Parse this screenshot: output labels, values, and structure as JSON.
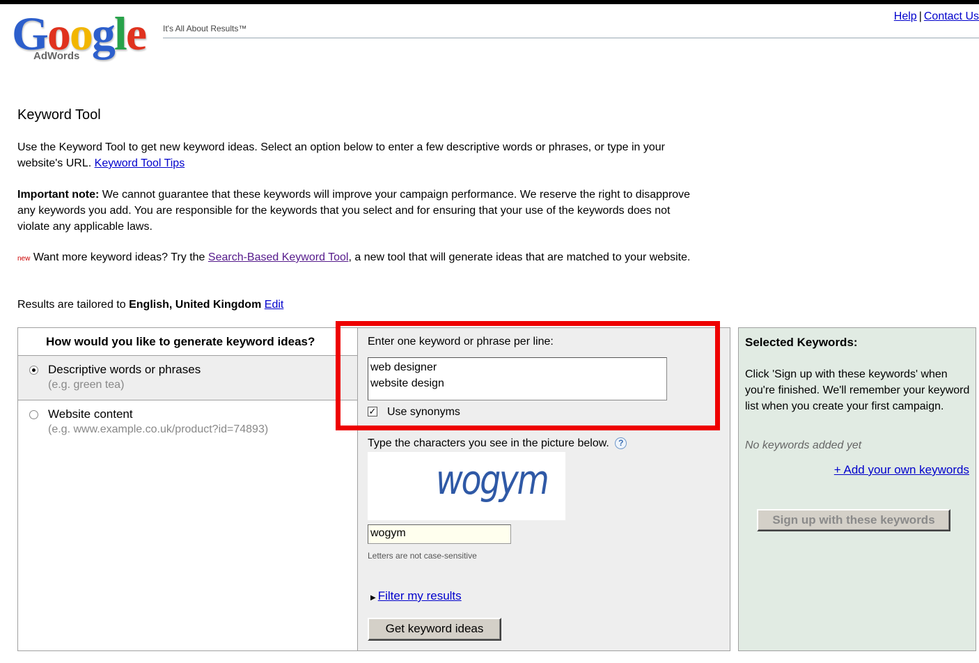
{
  "header": {
    "logo_text": "Google",
    "logo_sub": "AdWords",
    "tagline": "It's All About Results™",
    "help_link": "Help",
    "separator": "|",
    "contact_link": "Contact Us"
  },
  "intro": {
    "title": "Keyword Tool",
    "p1_text": "Use the Keyword Tool to get new keyword ideas. Select an option below to enter a few descriptive words or phrases, or type in your website's URL.",
    "p1_link": "Keyword Tool Tips",
    "p2_bold": "Important note:",
    "p2_text": "We cannot guarantee that these keywords will improve your campaign performance. We reserve the right to disapprove any keywords you add. You are responsible for the keywords that you select and for ensuring that your use of the keywords does not violate any applicable laws.",
    "p3_new": "new",
    "p3_before": "Want more keyword ideas? Try the",
    "p3_link": "Search-Based Keyword Tool",
    "p3_after": ", a new tool that will generate ideas that are matched to your website.",
    "p4_text": "Results are tailored to",
    "p4_bold": "English, United Kingdom",
    "p4_link": "Edit"
  },
  "left_panel": {
    "heading": "How would you like to generate keyword ideas?",
    "options": [
      {
        "label": "Descriptive words or phrases",
        "example": "(e.g. green tea)",
        "selected": true
      },
      {
        "label": "Website content",
        "example": "(e.g. www.example.co.uk/product?id=74893)",
        "selected": false
      }
    ]
  },
  "middle_panel": {
    "keyword_label": "Enter one keyword or phrase per line:",
    "keyword_line1": "web designer",
    "keyword_line2": "website design",
    "synonyms_label": "Use synonyms",
    "synonyms_checked": "✓",
    "captcha_label": "Type the characters you see in the picture below.",
    "help_icon": "?",
    "captcha_image_text": "wogym",
    "captcha_value": "wogym",
    "case_note": "Letters are not case-sensitive",
    "filter_link": "Filter my results",
    "get_button": "Get keyword ideas"
  },
  "right_panel": {
    "title": "Selected Keywords:",
    "instructions": "Click 'Sign up with these keywords' when you're finished. We'll remember your keyword list when you create your first campaign.",
    "empty_text": "No keywords added yet",
    "add_link": "+ Add your own keywords",
    "sign_button": "Sign up with these keywords"
  },
  "colors": {
    "highlight": "#ee0000",
    "link": "#0000cc",
    "right_panel_bg": "#e1ebe3"
  }
}
